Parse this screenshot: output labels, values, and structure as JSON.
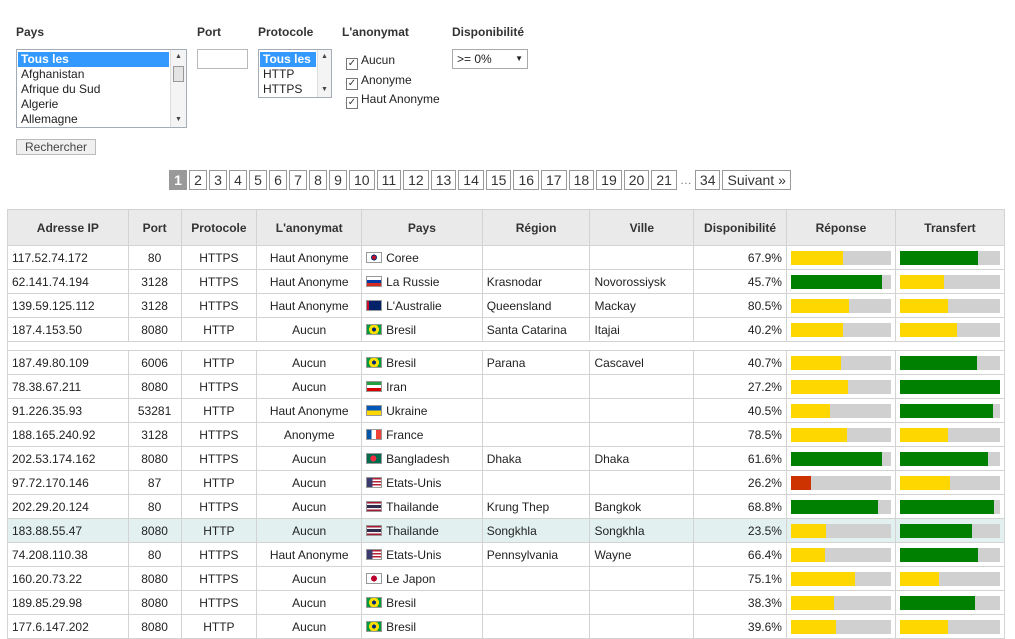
{
  "filters": {
    "pays_label": "Pays",
    "port_label": "Port",
    "protocole_label": "Protocole",
    "anonymat_label": "L'anonymat",
    "dispo_label": "Disponibilité",
    "pays_options": [
      "Tous les",
      "Afghanistan",
      "Afrique du Sud",
      "Algerie",
      "Allemagne"
    ],
    "protocole_options": [
      "Tous les",
      "HTTP",
      "HTTPS"
    ],
    "anonymat_options": [
      "Aucun",
      "Anonyme",
      "Haut Anonyme"
    ],
    "dispo_value": ">= 0%",
    "search_label": "Rechercher"
  },
  "pager": {
    "pages": [
      "1",
      "2",
      "3",
      "4",
      "5",
      "6",
      "7",
      "8",
      "9",
      "10",
      "11",
      "12",
      "13",
      "14",
      "15",
      "16",
      "17",
      "18",
      "19",
      "20",
      "21"
    ],
    "dots": "…",
    "last": "34",
    "next": "Suivant »"
  },
  "colors": {
    "yellow": "#ffd700",
    "green": "#008000",
    "red": "#cc3300",
    "grey": "#d0d0d0"
  },
  "table": {
    "headers": [
      "Adresse IP",
      "Port",
      "Protocole",
      "L'anonymat",
      "Pays",
      "Région",
      "Ville",
      "Disponibilité",
      "Réponse",
      "Transfert"
    ],
    "rows": [
      {
        "ip": "117.52.74.172",
        "port": "80",
        "proto": "HTTPS",
        "anon": "Haut Anonyme",
        "country": "Coree",
        "flag": "kr",
        "region": "",
        "city": "",
        "dispo": "67.9%",
        "resp": 0.52,
        "respColor": "yellow",
        "trans": 0.78,
        "transColor": "green"
      },
      {
        "ip": "62.141.74.194",
        "port": "3128",
        "proto": "HTTPS",
        "anon": "Haut Anonyme",
        "country": "La Russie",
        "flag": "ru",
        "region": "Krasnodar",
        "city": "Novorossiysk",
        "dispo": "45.7%",
        "resp": 0.91,
        "respColor": "green",
        "trans": 0.44,
        "transColor": "yellow"
      },
      {
        "ip": "139.59.125.112",
        "port": "3128",
        "proto": "HTTPS",
        "anon": "Haut Anonyme",
        "country": "L'Australie",
        "flag": "au",
        "region": "Queensland",
        "city": "Mackay",
        "dispo": "80.5%",
        "resp": 0.58,
        "respColor": "yellow",
        "trans": 0.48,
        "transColor": "yellow"
      },
      {
        "ip": "187.4.153.50",
        "port": "8080",
        "proto": "HTTP",
        "anon": "Aucun",
        "country": "Bresil",
        "flag": "br",
        "region": "Santa Catarina",
        "city": "Itajai",
        "dispo": "40.2%",
        "resp": 0.52,
        "respColor": "yellow",
        "trans": 0.57,
        "transColor": "yellow"
      },
      {
        "spacer": true
      },
      {
        "ip": "187.49.80.109",
        "port": "6006",
        "proto": "HTTP",
        "anon": "Aucun",
        "country": "Bresil",
        "flag": "br",
        "region": "Parana",
        "city": "Cascavel",
        "dispo": "40.7%",
        "resp": 0.5,
        "respColor": "yellow",
        "trans": 0.77,
        "transColor": "green"
      },
      {
        "ip": "78.38.67.211",
        "port": "8080",
        "proto": "HTTPS",
        "anon": "Aucun",
        "country": "Iran",
        "flag": "ir",
        "region": "",
        "city": "",
        "dispo": "27.2%",
        "resp": 0.57,
        "respColor": "yellow",
        "trans": 1.0,
        "transColor": "green"
      },
      {
        "ip": "91.226.35.93",
        "port": "53281",
        "proto": "HTTP",
        "anon": "Haut Anonyme",
        "country": "Ukraine",
        "flag": "ua",
        "region": "",
        "city": "",
        "dispo": "40.5%",
        "resp": 0.39,
        "respColor": "yellow",
        "trans": 0.93,
        "transColor": "green"
      },
      {
        "ip": "188.165.240.92",
        "port": "3128",
        "proto": "HTTPS",
        "anon": "Anonyme",
        "country": "France",
        "flag": "fr",
        "region": "",
        "city": "",
        "dispo": "78.5%",
        "resp": 0.56,
        "respColor": "yellow",
        "trans": 0.48,
        "transColor": "yellow"
      },
      {
        "ip": "202.53.174.162",
        "port": "8080",
        "proto": "HTTPS",
        "anon": "Aucun",
        "country": "Bangladesh",
        "flag": "bd",
        "region": "Dhaka",
        "city": "Dhaka",
        "dispo": "61.6%",
        "resp": 0.91,
        "respColor": "green",
        "trans": 0.88,
        "transColor": "green"
      },
      {
        "ip": "97.72.170.146",
        "port": "87",
        "proto": "HTTP",
        "anon": "Aucun",
        "country": "Etats-Unis",
        "flag": "us",
        "region": "",
        "city": "",
        "dispo": "26.2%",
        "resp": 0.2,
        "respColor": "red",
        "trans": 0.5,
        "transColor": "yellow"
      },
      {
        "ip": "202.29.20.124",
        "port": "80",
        "proto": "HTTPS",
        "anon": "Aucun",
        "country": "Thailande",
        "flag": "th",
        "region": "Krung Thep",
        "city": "Bangkok",
        "dispo": "68.8%",
        "resp": 0.87,
        "respColor": "green",
        "trans": 0.94,
        "transColor": "green"
      },
      {
        "ip": "183.88.55.47",
        "port": "8080",
        "proto": "HTTP",
        "anon": "Aucun",
        "country": "Thailande",
        "flag": "th",
        "region": "Songkhla",
        "city": "Songkhla",
        "dispo": "23.5%",
        "resp": 0.35,
        "respColor": "yellow",
        "trans": 0.72,
        "transColor": "green",
        "hl": true
      },
      {
        "ip": "74.208.110.38",
        "port": "80",
        "proto": "HTTPS",
        "anon": "Haut Anonyme",
        "country": "Etats-Unis",
        "flag": "us",
        "region": "Pennsylvania",
        "city": "Wayne",
        "dispo": "66.4%",
        "resp": 0.34,
        "respColor": "yellow",
        "trans": 0.78,
        "transColor": "green"
      },
      {
        "ip": "160.20.73.22",
        "port": "8080",
        "proto": "HTTPS",
        "anon": "Aucun",
        "country": "Le Japon",
        "flag": "jp",
        "region": "",
        "city": "",
        "dispo": "75.1%",
        "resp": 0.64,
        "respColor": "yellow",
        "trans": 0.39,
        "transColor": "yellow"
      },
      {
        "ip": "189.85.29.98",
        "port": "8080",
        "proto": "HTTPS",
        "anon": "Aucun",
        "country": "Bresil",
        "flag": "br",
        "region": "",
        "city": "",
        "dispo": "38.3%",
        "resp": 0.43,
        "respColor": "yellow",
        "trans": 0.75,
        "transColor": "green"
      },
      {
        "ip": "177.6.147.202",
        "port": "8080",
        "proto": "HTTP",
        "anon": "Aucun",
        "country": "Bresil",
        "flag": "br",
        "region": "",
        "city": "",
        "dispo": "39.6%",
        "resp": 0.45,
        "respColor": "yellow",
        "trans": 0.48,
        "transColor": "yellow"
      }
    ]
  }
}
